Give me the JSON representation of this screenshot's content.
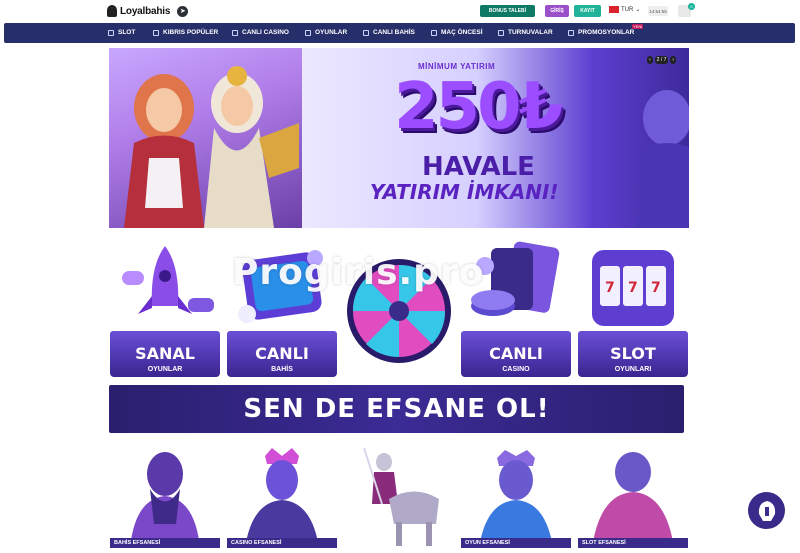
{
  "header": {
    "logo_text": "Loyalbahis",
    "bonus_label": "BONUS TALEBİ",
    "login_label": "GİRİŞ",
    "register_label": "KAYIT",
    "lang_label": "TUR",
    "clock_label": "14:54:55",
    "notif_count": "0"
  },
  "nav": {
    "items": [
      {
        "label": "SLOT"
      },
      {
        "label": "KIBRIS POPÜLER"
      },
      {
        "label": "CANLI CASINO"
      },
      {
        "label": "OYUNLAR"
      },
      {
        "label": "CANLI BAHİS"
      },
      {
        "label": "MAÇ ÖNCESİ"
      },
      {
        "label": "TURNUVALAR"
      },
      {
        "label": "PROMOSYONLAR"
      }
    ],
    "new_badge": "YENİ"
  },
  "banner": {
    "small": "MİNİMUM YATIRIM",
    "amount": "250₺",
    "havale": "HAVALE",
    "sub": "YATIRIM İMKANI!",
    "slider_prev": "‹",
    "slider_counter": "2 / 7",
    "slider_next": "›"
  },
  "watermark": "Progiris.pro",
  "categories": [
    {
      "title": "SANAL",
      "sub": "OYUNLAR"
    },
    {
      "title": "CANLI",
      "sub": "BAHİS"
    },
    {
      "title": "",
      "sub": ""
    },
    {
      "title": "CANLI",
      "sub": "CASINO"
    },
    {
      "title": "SLOT",
      "sub": "OYUNLARI"
    }
  ],
  "efsane": "SEN DE EFSANE OL!",
  "busts": [
    {
      "label": "BAHİS EFSANESİ"
    },
    {
      "label": "CASINO EFSANESİ"
    },
    {
      "label": ""
    },
    {
      "label": "OYUN EFSANESİ"
    },
    {
      "label": "SLOT EFSANESİ"
    }
  ],
  "colors": {
    "nav_bg": "#262f6a",
    "bonus_btn": "#0e7a63",
    "login_btn": "#9b4fc9",
    "register_btn": "#20b39a"
  }
}
